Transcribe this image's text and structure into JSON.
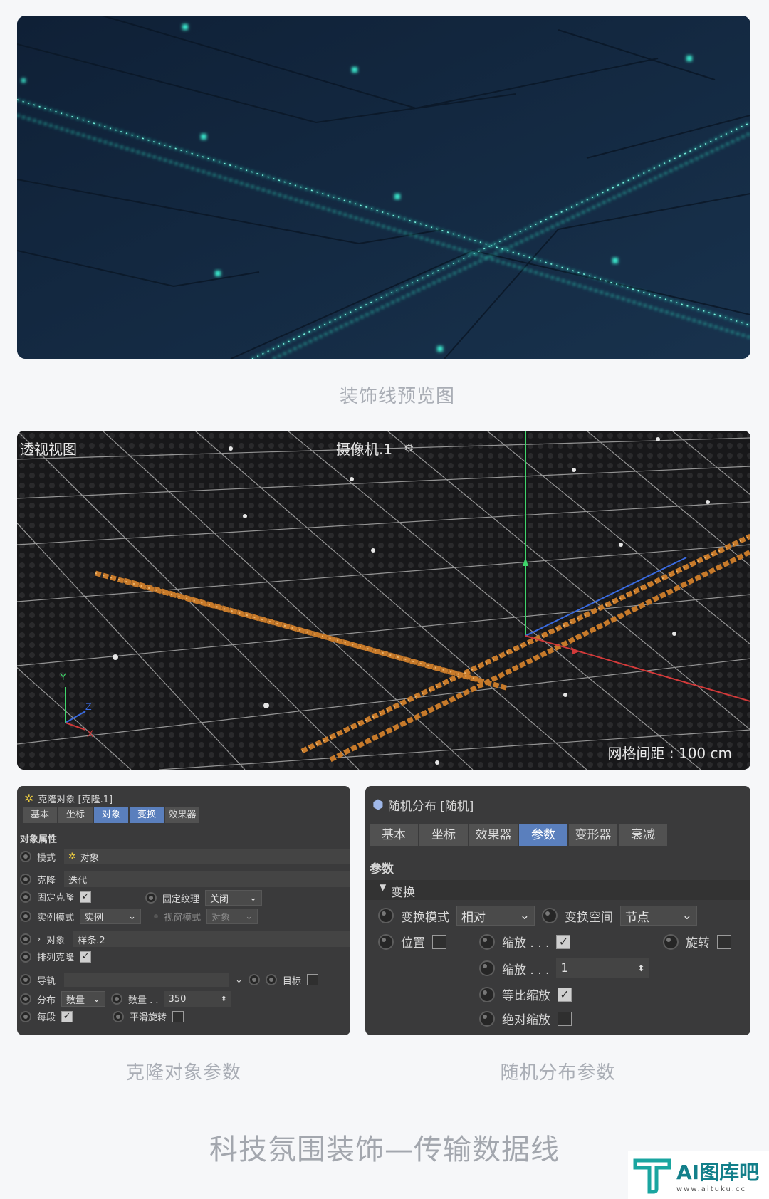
{
  "preview": {
    "caption": "装饰线预览图"
  },
  "viewport": {
    "view_label": "透视视图",
    "camera_label": "摄像机.1",
    "grid_spacing": "网格间距 : 100 cm",
    "axis_labels": {
      "x": "X",
      "y": "Y",
      "z": "Z"
    }
  },
  "clone_panel": {
    "title": "克隆对象 [克隆.1]",
    "tabs": [
      "基本",
      "坐标",
      "对象",
      "变换",
      "效果器"
    ],
    "active_tab": 2,
    "section": "对象属性",
    "mode_label": "模式",
    "mode_value": "对象",
    "clone_label": "克隆",
    "clone_value": "迭代",
    "fixed_clone_label": "固定克隆",
    "fixed_texture_label": "固定纹理",
    "fixed_texture_value": "关闭",
    "instance_mode_label": "实例模式",
    "instance_mode_value": "实例",
    "viewport_mode_label": "视窗模式",
    "viewport_mode_value": "对象",
    "object_label": "对象",
    "object_value": "样条.2",
    "arrange_clone_label": "排列克隆",
    "rail_label": "导轨",
    "target_label": "目标",
    "distribution_label": "分布",
    "distribution_value": "数量",
    "count_label": "数量 . .",
    "count_value": "350",
    "per_segment_label": "每段",
    "smooth_rotation_label": "平滑旋转",
    "caption": "克隆对象参数"
  },
  "random_panel": {
    "title": "随机分布 [随机]",
    "tabs": [
      "基本",
      "坐标",
      "效果器",
      "参数",
      "变形器",
      "衰减"
    ],
    "active_tab": 3,
    "section": "参数",
    "group": "变换",
    "transform_mode_label": "变换模式",
    "transform_mode_value": "相对",
    "transform_space_label": "变换空间",
    "transform_space_value": "节点",
    "position_label": "位置",
    "scale_label": "缩放 . . .",
    "rotation_label": "旋转",
    "scale_value_label": "缩放 . . .",
    "scale_value": "1",
    "uniform_scale_label": "等比缩放",
    "absolute_scale_label": "绝对缩放",
    "caption": "随机分布参数"
  },
  "footer": {
    "title": "科技氛围装饰—传输数据线"
  },
  "logo": {
    "text": "AI图库吧",
    "url_text": "www.aituku.cc"
  },
  "colors": {
    "accent_cyan": "#2ee6c8",
    "orange_clone": "#c77a2a",
    "tab_active": "#5a7fbd"
  }
}
